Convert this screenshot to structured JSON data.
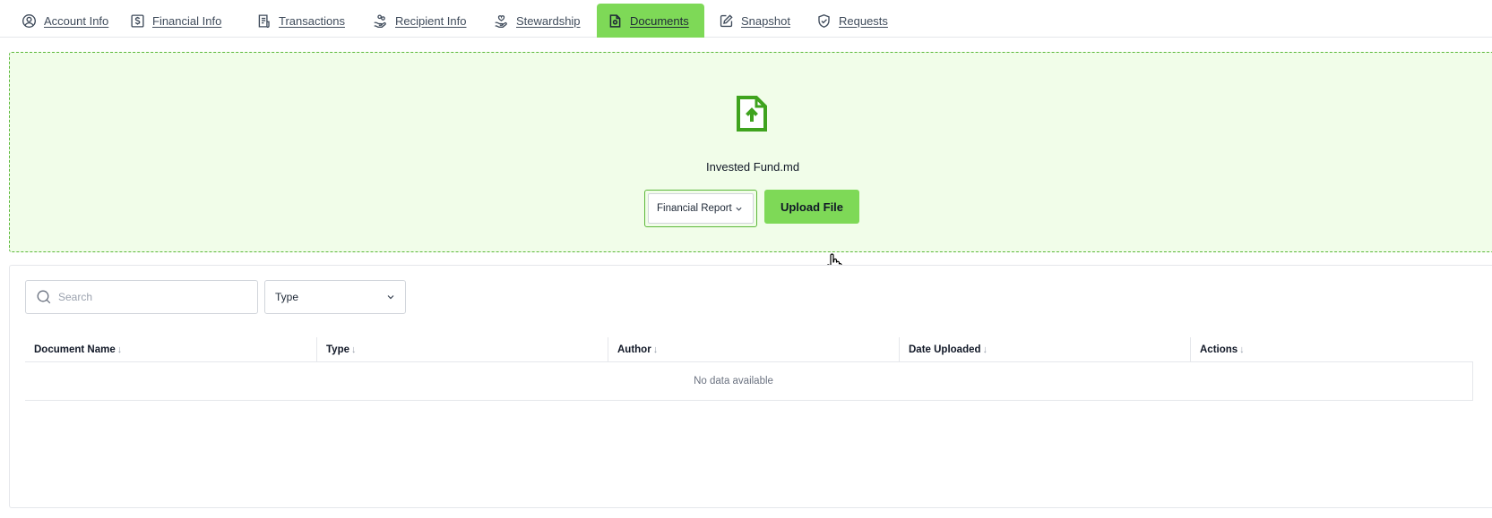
{
  "tabs": [
    {
      "label": "Account Info",
      "icon": "user-circle-icon",
      "active": false
    },
    {
      "label": "Financial Info",
      "icon": "dollar-square-icon",
      "active": false
    },
    {
      "label": "Transactions",
      "icon": "receipt-icon",
      "active": false
    },
    {
      "label": "Recipient Info",
      "icon": "hand-coins-icon",
      "active": false
    },
    {
      "label": "Stewardship",
      "icon": "hand-heart-icon",
      "active": false
    },
    {
      "label": "Documents",
      "icon": "document-icon",
      "active": true
    },
    {
      "label": "Snapshot",
      "icon": "edit-note-icon",
      "active": false
    },
    {
      "label": "Requests",
      "icon": "shield-check-icon",
      "active": false
    }
  ],
  "upload": {
    "icon": "file-upload-icon",
    "file_name": "Invested Fund.md",
    "document_type": "Financial Report",
    "button_label": "Upload File"
  },
  "filters": {
    "search_placeholder": "Search",
    "type_label": "Type"
  },
  "table": {
    "columns": [
      "Document Name",
      "Type",
      "Author",
      "Date Uploaded",
      "Actions"
    ],
    "sort_arrow": "↓",
    "empty_message": "No data available"
  },
  "colors": {
    "accent": "#7ed957",
    "accent_dark": "#3fa31e",
    "dropzone_bg": "#f1fde9"
  }
}
